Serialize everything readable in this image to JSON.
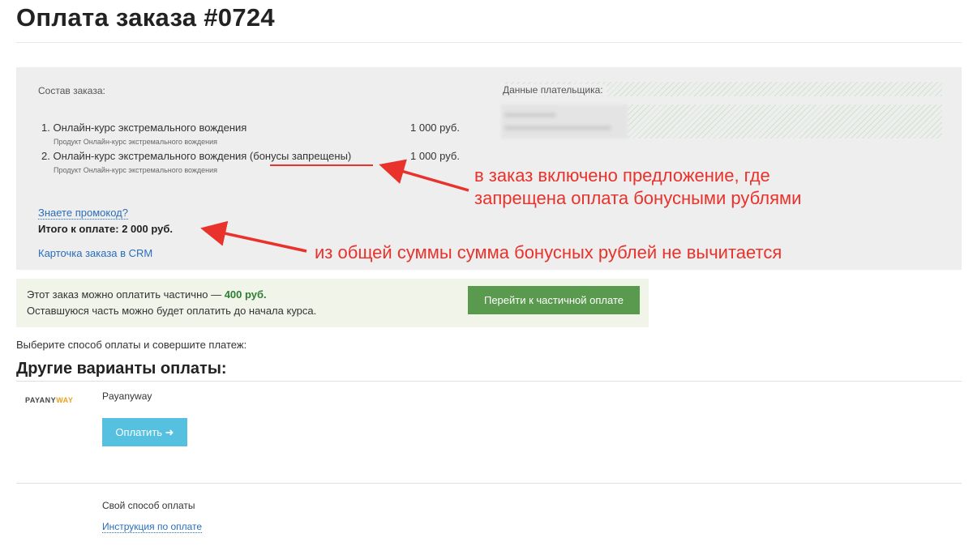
{
  "header": {
    "title": "Оплата заказа #0724"
  },
  "order": {
    "composition_label": "Состав заказа:",
    "items": [
      {
        "name": "1. Онлайн-курс экстремального вождения",
        "sub": "Продукт Онлайн-курс экстремального вождения",
        "price": "1 000 руб."
      },
      {
        "name_prefix": "2. Онлайн-курс экстремального вождения ",
        "name_highlight": "(бонусы запрещены)",
        "sub": "Продукт Онлайн-курс экстремального вождения",
        "price": "1 000 руб."
      }
    ],
    "promo_link": "Знаете промокод?",
    "total": "Итого к оплате: 2 000 руб.",
    "crm_link": "Карточка заказа в CRM",
    "payer_label": "Данные плательщика:"
  },
  "annotations": {
    "bonus_note_line1": "в заказ включено предложение, где",
    "bonus_note_line2": "запрещена оплата бонусными рублями",
    "total_note": "из общей суммы сумма бонусных рублей не вычитается"
  },
  "partial": {
    "text_prefix": "Этот заказ можно оплатить частично — ",
    "amount": "400 руб.",
    "text_line2": "Оставшуюся часть можно будет оплатить до начала курса.",
    "button": "Перейти к частичной оплате"
  },
  "payment": {
    "choose_text": "Выберите способ оплаты и совершите платеж:",
    "other_title": "Другие варианты оплаты:",
    "payanyway_logo_a": "PAYANY",
    "payanyway_logo_b": "WAY",
    "payanyway_name": "Payanyway",
    "pay_button": "Оплатить",
    "pay_button_icon": "➜",
    "custom_method": "Свой способ оплаты",
    "instructions_link": "Инструкция по оплате"
  },
  "colors": {
    "annotation": "#e8322b",
    "partial_button": "#5a9a4e",
    "pay_button": "#55c0df",
    "link": "#2a6ebb"
  }
}
